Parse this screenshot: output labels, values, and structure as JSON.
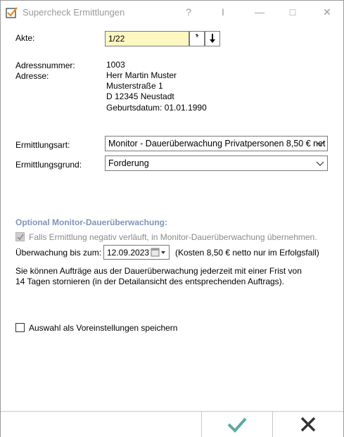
{
  "window": {
    "title": "Supercheck Ermittlungen",
    "help_glyph": "?",
    "pin_glyph": "I",
    "minimize_glyph": "—",
    "maximize_glyph": "□",
    "close_glyph": "✕"
  },
  "akte": {
    "label": "Akte:",
    "value": "1/22",
    "btn1_glyph": "⸙",
    "btn2_glyph": "↓"
  },
  "adressnummer": {
    "label": "Adressnummer:",
    "value": "1003"
  },
  "adresse": {
    "label": "Adresse:",
    "lines": [
      "Herr Martin Muster",
      "Musterstraße 1",
      "D 12345 Neustadt",
      "Geburtsdatum: 01.01.1990"
    ]
  },
  "ermittlungsart": {
    "label": "Ermittlungsart:",
    "selected": "Monitor - Dauerüberwachung Privatpersonen 8,50 € net"
  },
  "ermittlungsgrund": {
    "label": "Ermittlungsgrund:",
    "selected": "Forderung"
  },
  "monitor": {
    "section_title": "Optional Monitor-Dauerüberwachung:",
    "checkbox_label": "Falls Ermittlung negativ verläuft, in Monitor-Dauerüberwachung übernehmen.",
    "checkbox_checked": true,
    "until_label": "Überwachung bis zum:",
    "until_value": "12.09.2023",
    "cost_note": "(Kosten 8,50 € netto nur im Erfolgsfall)",
    "info_line1": "Sie können Aufträge aus der Dauerüberwachung jederzeit mit einer Frist von",
    "info_line2": "14 Tagen stornieren (in der Detailansicht des entsprechenden Auftrags)."
  },
  "defaults": {
    "checkbox_label": "Auswahl als Voreinstellungen speichern",
    "checked": false
  },
  "colors": {
    "accent_check": "#5aa9a0",
    "section_title": "#7e95b8",
    "akte_bg": "#fff7c2",
    "app_icon_orange": "#e8892a"
  }
}
